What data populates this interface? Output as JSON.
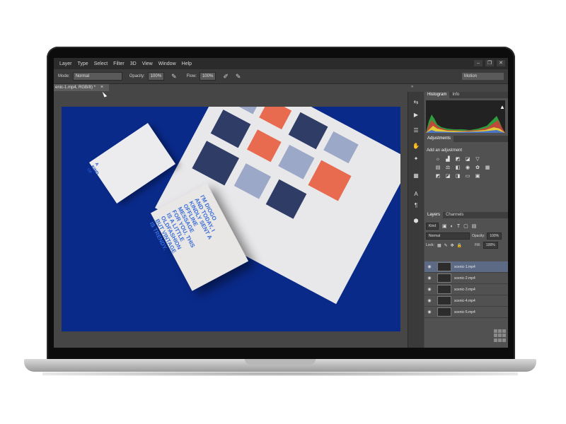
{
  "menu": [
    "Layer",
    "Type",
    "Select",
    "Filter",
    "3D",
    "View",
    "Window",
    "Help"
  ],
  "options": {
    "mode_label": "Mode:",
    "mode_value": "Normal",
    "opacity_label": "Opacity:",
    "opacity_value": "100%",
    "flow_label": "Flow:",
    "flow_value": "100%",
    "workspace": "Motion"
  },
  "document_tab": {
    "title": "enic-1.mp4, RGB/8) *",
    "close": "×"
  },
  "canvas": {
    "background": "#0a2a8a",
    "card1_text": "A\nKIND\nOF",
    "card2_text": "I'M DIOGO\nAND TODAY, I\nKINDLY SENT A\nOFFLINE\nMESSAGE\nFOR YOU. THIS\nIS A LITTLE\nOLDFASHION\nBUT VINTAGE\nIS TRENDY."
  },
  "panels": {
    "histogram_tabs": [
      "Histogram",
      "Info"
    ],
    "adjustments_tab": "Adjustments",
    "adjustments_title": "Add an adjustment",
    "layers_tabs": [
      "Layers",
      "Channels"
    ],
    "kind_label": "Kind",
    "blend_mode": "Normal",
    "opacity_label": "Opacity:",
    "opacity_value": "100%",
    "lock_label": "Lock:",
    "fill_label": "Fill:",
    "fill_value": "100%"
  },
  "layers": [
    {
      "name": "scenic-1.mp4",
      "selected": true
    },
    {
      "name": "scenic-2.mp4",
      "selected": false
    },
    {
      "name": "scenic-3.mp4",
      "selected": false
    },
    {
      "name": "scenic-4.mp4",
      "selected": false
    },
    {
      "name": "scenic-5.mp4",
      "selected": false
    }
  ],
  "colors": {
    "ui_dark": "#2b2b2b",
    "panel": "#515151",
    "selection": "#5d6a86"
  }
}
